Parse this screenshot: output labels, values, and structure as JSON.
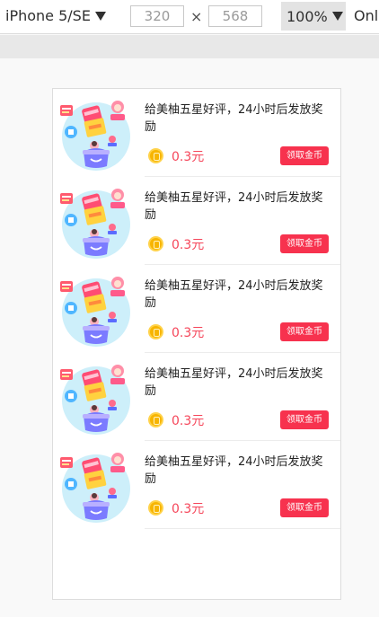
{
  "toolbar": {
    "device": "iPhone 5/SE",
    "width": "320",
    "height": "568",
    "times": "×",
    "zoom": "100%",
    "network": "Onl"
  },
  "colors": {
    "accent": "#f7324e",
    "reward_text": "#f5465a",
    "coin": "#f7b500"
  },
  "tasks": [
    {
      "title": "给美柚五星好评，24小时后发放奖励",
      "reward": "0.3元",
      "button": "领取金币",
      "image_icon": "gift-bag-illustration"
    },
    {
      "title": "给美柚五星好评，24小时后发放奖励",
      "reward": "0.3元",
      "button": "领取金币",
      "image_icon": "gift-bag-illustration"
    },
    {
      "title": "给美柚五星好评，24小时后发放奖励",
      "reward": "0.3元",
      "button": "领取金币",
      "image_icon": "gift-bag-illustration"
    },
    {
      "title": "给美柚五星好评，24小时后发放奖励",
      "reward": "0.3元",
      "button": "领取金币",
      "image_icon": "gift-bag-illustration"
    },
    {
      "title": "给美柚五星好评，24小时后发放奖励",
      "reward": "0.3元",
      "button": "领取金币",
      "image_icon": "gift-bag-illustration"
    }
  ]
}
